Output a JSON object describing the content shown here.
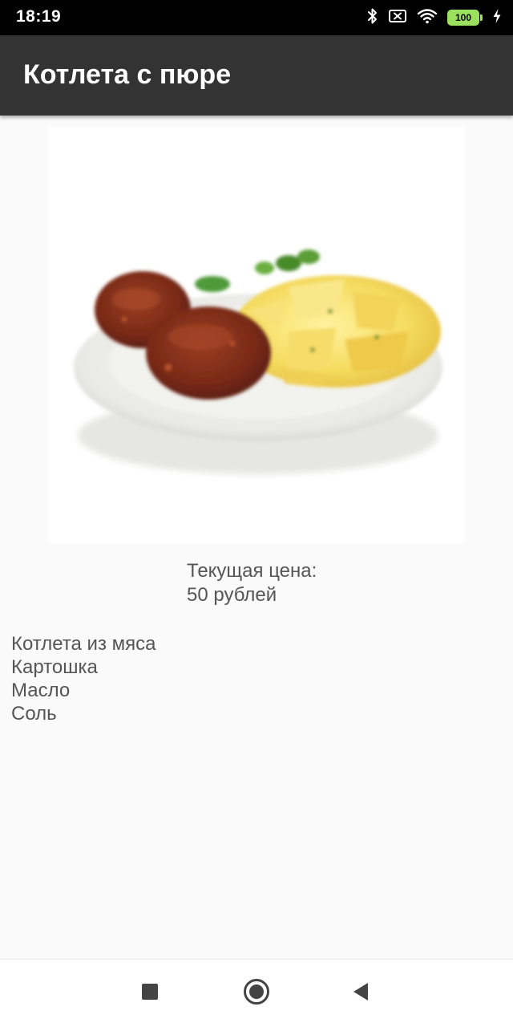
{
  "status_bar": {
    "time": "18:19",
    "battery_level": "100",
    "icons": [
      "bluetooth-icon",
      "sim-off-icon",
      "wifi-icon",
      "battery-icon",
      "charging-icon"
    ]
  },
  "app_bar": {
    "title": "Котлета с пюре"
  },
  "dish": {
    "image": "cutlet-with-mashed-potatoes-photo"
  },
  "price": {
    "label": "Текущая цена:",
    "value": "50 рублей"
  },
  "ingredients": [
    "Котлета из мяса",
    "Картошка",
    "Масло",
    "Соль"
  ],
  "nav_bar": {
    "buttons": [
      "recents-icon",
      "home-icon",
      "back-icon"
    ]
  },
  "colors": {
    "status_bar": "#000000",
    "app_bar": "#333333",
    "background": "#fafafa",
    "text": "#555555",
    "battery": "#9be15d"
  }
}
